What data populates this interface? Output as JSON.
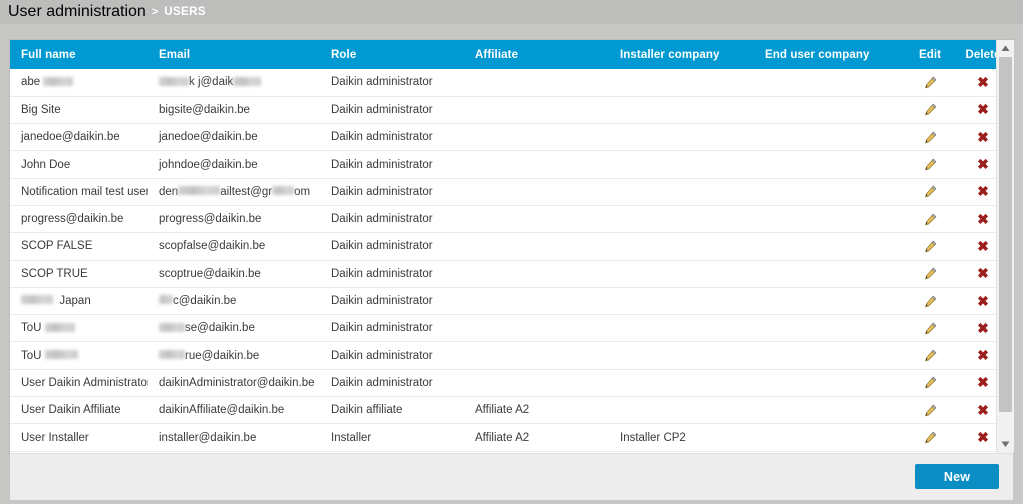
{
  "breadcrumb": {
    "root": "User administration",
    "separator": ">",
    "current": "USERS"
  },
  "table": {
    "columns": [
      {
        "key": "full_name",
        "label": "Full name"
      },
      {
        "key": "email",
        "label": "Email"
      },
      {
        "key": "role",
        "label": "Role"
      },
      {
        "key": "affiliate",
        "label": "Affiliate"
      },
      {
        "key": "installer_company",
        "label": "Installer company"
      },
      {
        "key": "end_user_company",
        "label": "End user company"
      },
      {
        "key": "edit",
        "label": "Edit"
      },
      {
        "key": "delete",
        "label": "Delete"
      }
    ],
    "rows": [
      {
        "full_name": "abe",
        "full_name_redacted": true,
        "email": "@daik",
        "email_redacted": true,
        "role": "Daikin administrator",
        "affiliate": "",
        "installer_company": "",
        "end_user_company": ""
      },
      {
        "full_name": "Big Site",
        "email": "bigsite@daikin.be",
        "role": "Daikin administrator",
        "affiliate": "",
        "installer_company": "",
        "end_user_company": ""
      },
      {
        "full_name": "janedoe@daikin.be",
        "email": "janedoe@daikin.be",
        "role": "Daikin administrator",
        "affiliate": "",
        "installer_company": "",
        "end_user_company": ""
      },
      {
        "full_name": "John Doe",
        "email": "johndoe@daikin.be",
        "role": "Daikin administrator",
        "affiliate": "",
        "installer_company": "",
        "end_user_company": ""
      },
      {
        "full_name": "Notification mail test user",
        "email": "den        ailtest@gr     om",
        "email_redacted": true,
        "role": "Daikin administrator",
        "affiliate": "",
        "installer_company": "",
        "end_user_company": ""
      },
      {
        "full_name": "progress@daikin.be",
        "email": "progress@daikin.be",
        "role": "Daikin administrator",
        "affiliate": "",
        "installer_company": "",
        "end_user_company": ""
      },
      {
        "full_name": "SCOP FALSE",
        "email": "scopfalse@daikin.be",
        "role": "Daikin administrator",
        "affiliate": "",
        "installer_company": "",
        "end_user_company": ""
      },
      {
        "full_name": "SCOP TRUE",
        "email": "scoptrue@daikin.be",
        "role": "Daikin administrator",
        "affiliate": "",
        "installer_company": "",
        "end_user_company": ""
      },
      {
        "full_name": "Japan",
        "full_name_redacted": true,
        "email": "c@daikin.be",
        "email_redacted": true,
        "role": "Daikin administrator",
        "affiliate": "",
        "installer_company": "",
        "end_user_company": ""
      },
      {
        "full_name": "ToU",
        "full_name_redacted": true,
        "email": "se@daikin.be",
        "email_redacted": true,
        "role": "Daikin administrator",
        "affiliate": "",
        "installer_company": "",
        "end_user_company": ""
      },
      {
        "full_name": "ToU",
        "full_name_redacted": true,
        "email": "rue@daikin.be",
        "email_redacted": true,
        "role": "Daikin administrator",
        "affiliate": "",
        "installer_company": "",
        "end_user_company": ""
      },
      {
        "full_name": "User Daikin Administrator",
        "email": "daikinAdministrator@daikin.be",
        "role": "Daikin administrator",
        "affiliate": "",
        "installer_company": "",
        "end_user_company": ""
      },
      {
        "full_name": "User Daikin Affiliate",
        "email": "daikinAffiliate@daikin.be",
        "role": "Daikin affiliate",
        "affiliate": "Affiliate A2",
        "installer_company": "",
        "end_user_company": ""
      },
      {
        "full_name": "User Installer",
        "email": "installer@daikin.be",
        "role": "Installer",
        "affiliate": "Affiliate A2",
        "installer_company": "Installer CP2",
        "end_user_company": ""
      }
    ],
    "row_actions": {
      "edit_icon": "pencil-icon",
      "delete_icon": "cross-icon"
    }
  },
  "footer": {
    "new_label": "New"
  },
  "scrollbar": {
    "up_icon": "chevron-up-icon",
    "down_icon": "chevron-down-icon"
  },
  "colors": {
    "header_blue": "#0099d2",
    "button_blue": "#0b8ec4",
    "delete_red": "#9c1f1f",
    "pencil_gold": "#e0b03a",
    "page_grey": "#c7c7c5",
    "breadcrumb_grey": "#bdbdbb"
  }
}
